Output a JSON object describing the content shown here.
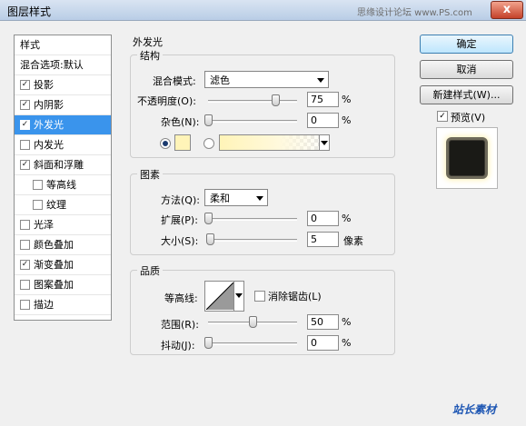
{
  "window": {
    "title": "图层样式",
    "watermark": "思缘设计论坛 www.PS.com",
    "close_label": "x"
  },
  "style_list": {
    "header": "样式",
    "blend_default": "混合选项:默认",
    "items": [
      {
        "label": "投影",
        "checked": true,
        "indent": false
      },
      {
        "label": "内阴影",
        "checked": true,
        "indent": false
      },
      {
        "label": "外发光",
        "checked": true,
        "indent": false,
        "selected": true
      },
      {
        "label": "内发光",
        "checked": false,
        "indent": false
      },
      {
        "label": "斜面和浮雕",
        "checked": true,
        "indent": false
      },
      {
        "label": "等高线",
        "checked": false,
        "indent": true
      },
      {
        "label": "纹理",
        "checked": false,
        "indent": true
      },
      {
        "label": "光泽",
        "checked": false,
        "indent": false
      },
      {
        "label": "颜色叠加",
        "checked": false,
        "indent": false
      },
      {
        "label": "渐变叠加",
        "checked": true,
        "indent": false
      },
      {
        "label": "图案叠加",
        "checked": false,
        "indent": false
      },
      {
        "label": "描边",
        "checked": false,
        "indent": false
      }
    ]
  },
  "panel": {
    "title": "外发光",
    "structure": {
      "legend": "结构",
      "blend_mode_label": "混合模式:",
      "blend_mode_value": "滤色",
      "opacity_label": "不透明度(O):",
      "opacity_value": "75",
      "opacity_unit": "%",
      "opacity_level": 0.75,
      "noise_label": "杂色(N):",
      "noise_value": "0",
      "noise_unit": "%",
      "noise_level": 0,
      "glow_color": "#fff4b8"
    },
    "elements": {
      "legend": "图素",
      "method_label": "方法(Q):",
      "method_value": "柔和",
      "spread_label": "扩展(P):",
      "spread_value": "0",
      "spread_unit": "%",
      "spread_level": 0,
      "size_label": "大小(S):",
      "size_value": "5",
      "size_unit": "像素",
      "size_level": 0.02
    },
    "quality": {
      "legend": "品质",
      "contour_label": "等高线:",
      "antialias_label": "消除锯齿(L)",
      "range_label": "范围(R):",
      "range_value": "50",
      "range_unit": "%",
      "range_level": 0.5,
      "jitter_label": "抖动(J):",
      "jitter_value": "0",
      "jitter_unit": "%",
      "jitter_level": 0
    }
  },
  "buttons": {
    "ok": "确定",
    "cancel": "取消",
    "new_style": "新建样式(W)...",
    "preview": "预览(V)"
  },
  "footer_logo": "站长素材"
}
